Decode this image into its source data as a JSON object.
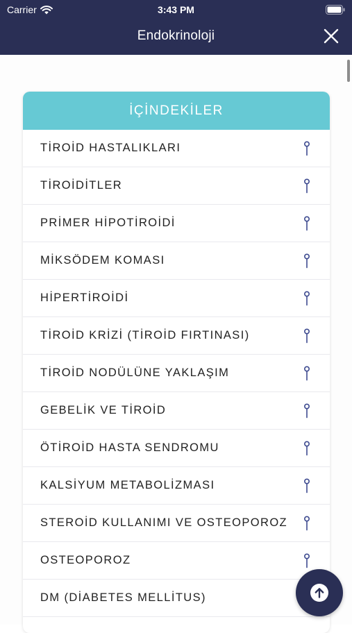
{
  "status_bar": {
    "carrier": "Carrier",
    "time": "3:43 PM"
  },
  "nav": {
    "title": "Endokrinoloji"
  },
  "toc": {
    "header": "İÇİNDEKİLER",
    "items": [
      "TİROİD HASTALIKLARI",
      "TİROİDİTLER",
      "PRİMER HİPOTİROİDİ",
      "MİKSÖDEM KOMASI",
      "HİPERTİROİDİ",
      "TİROİD KRİZİ (TİROİD FIRTINASI)",
      "TİROİD NODÜLÜNE YAKLAŞIM",
      "GEBELİK VE TİROİD",
      "ÖTİROİD HASTA SENDROMU",
      "KALSİYUM METABOLİZMASI",
      "STEROİD KULLANIMI VE OSTEOPOROZ",
      "OSTEOPOROZ",
      "DM (DİABETES MELLİTUS)"
    ]
  },
  "colors": {
    "nav_bg": "#2a2f55",
    "toc_header_bg": "#66c9d4",
    "pin_icon": "#3d4a8f"
  },
  "icons": [
    "wifi-icon",
    "battery-icon",
    "close-icon",
    "pin-icon",
    "arrow-up-icon"
  ]
}
